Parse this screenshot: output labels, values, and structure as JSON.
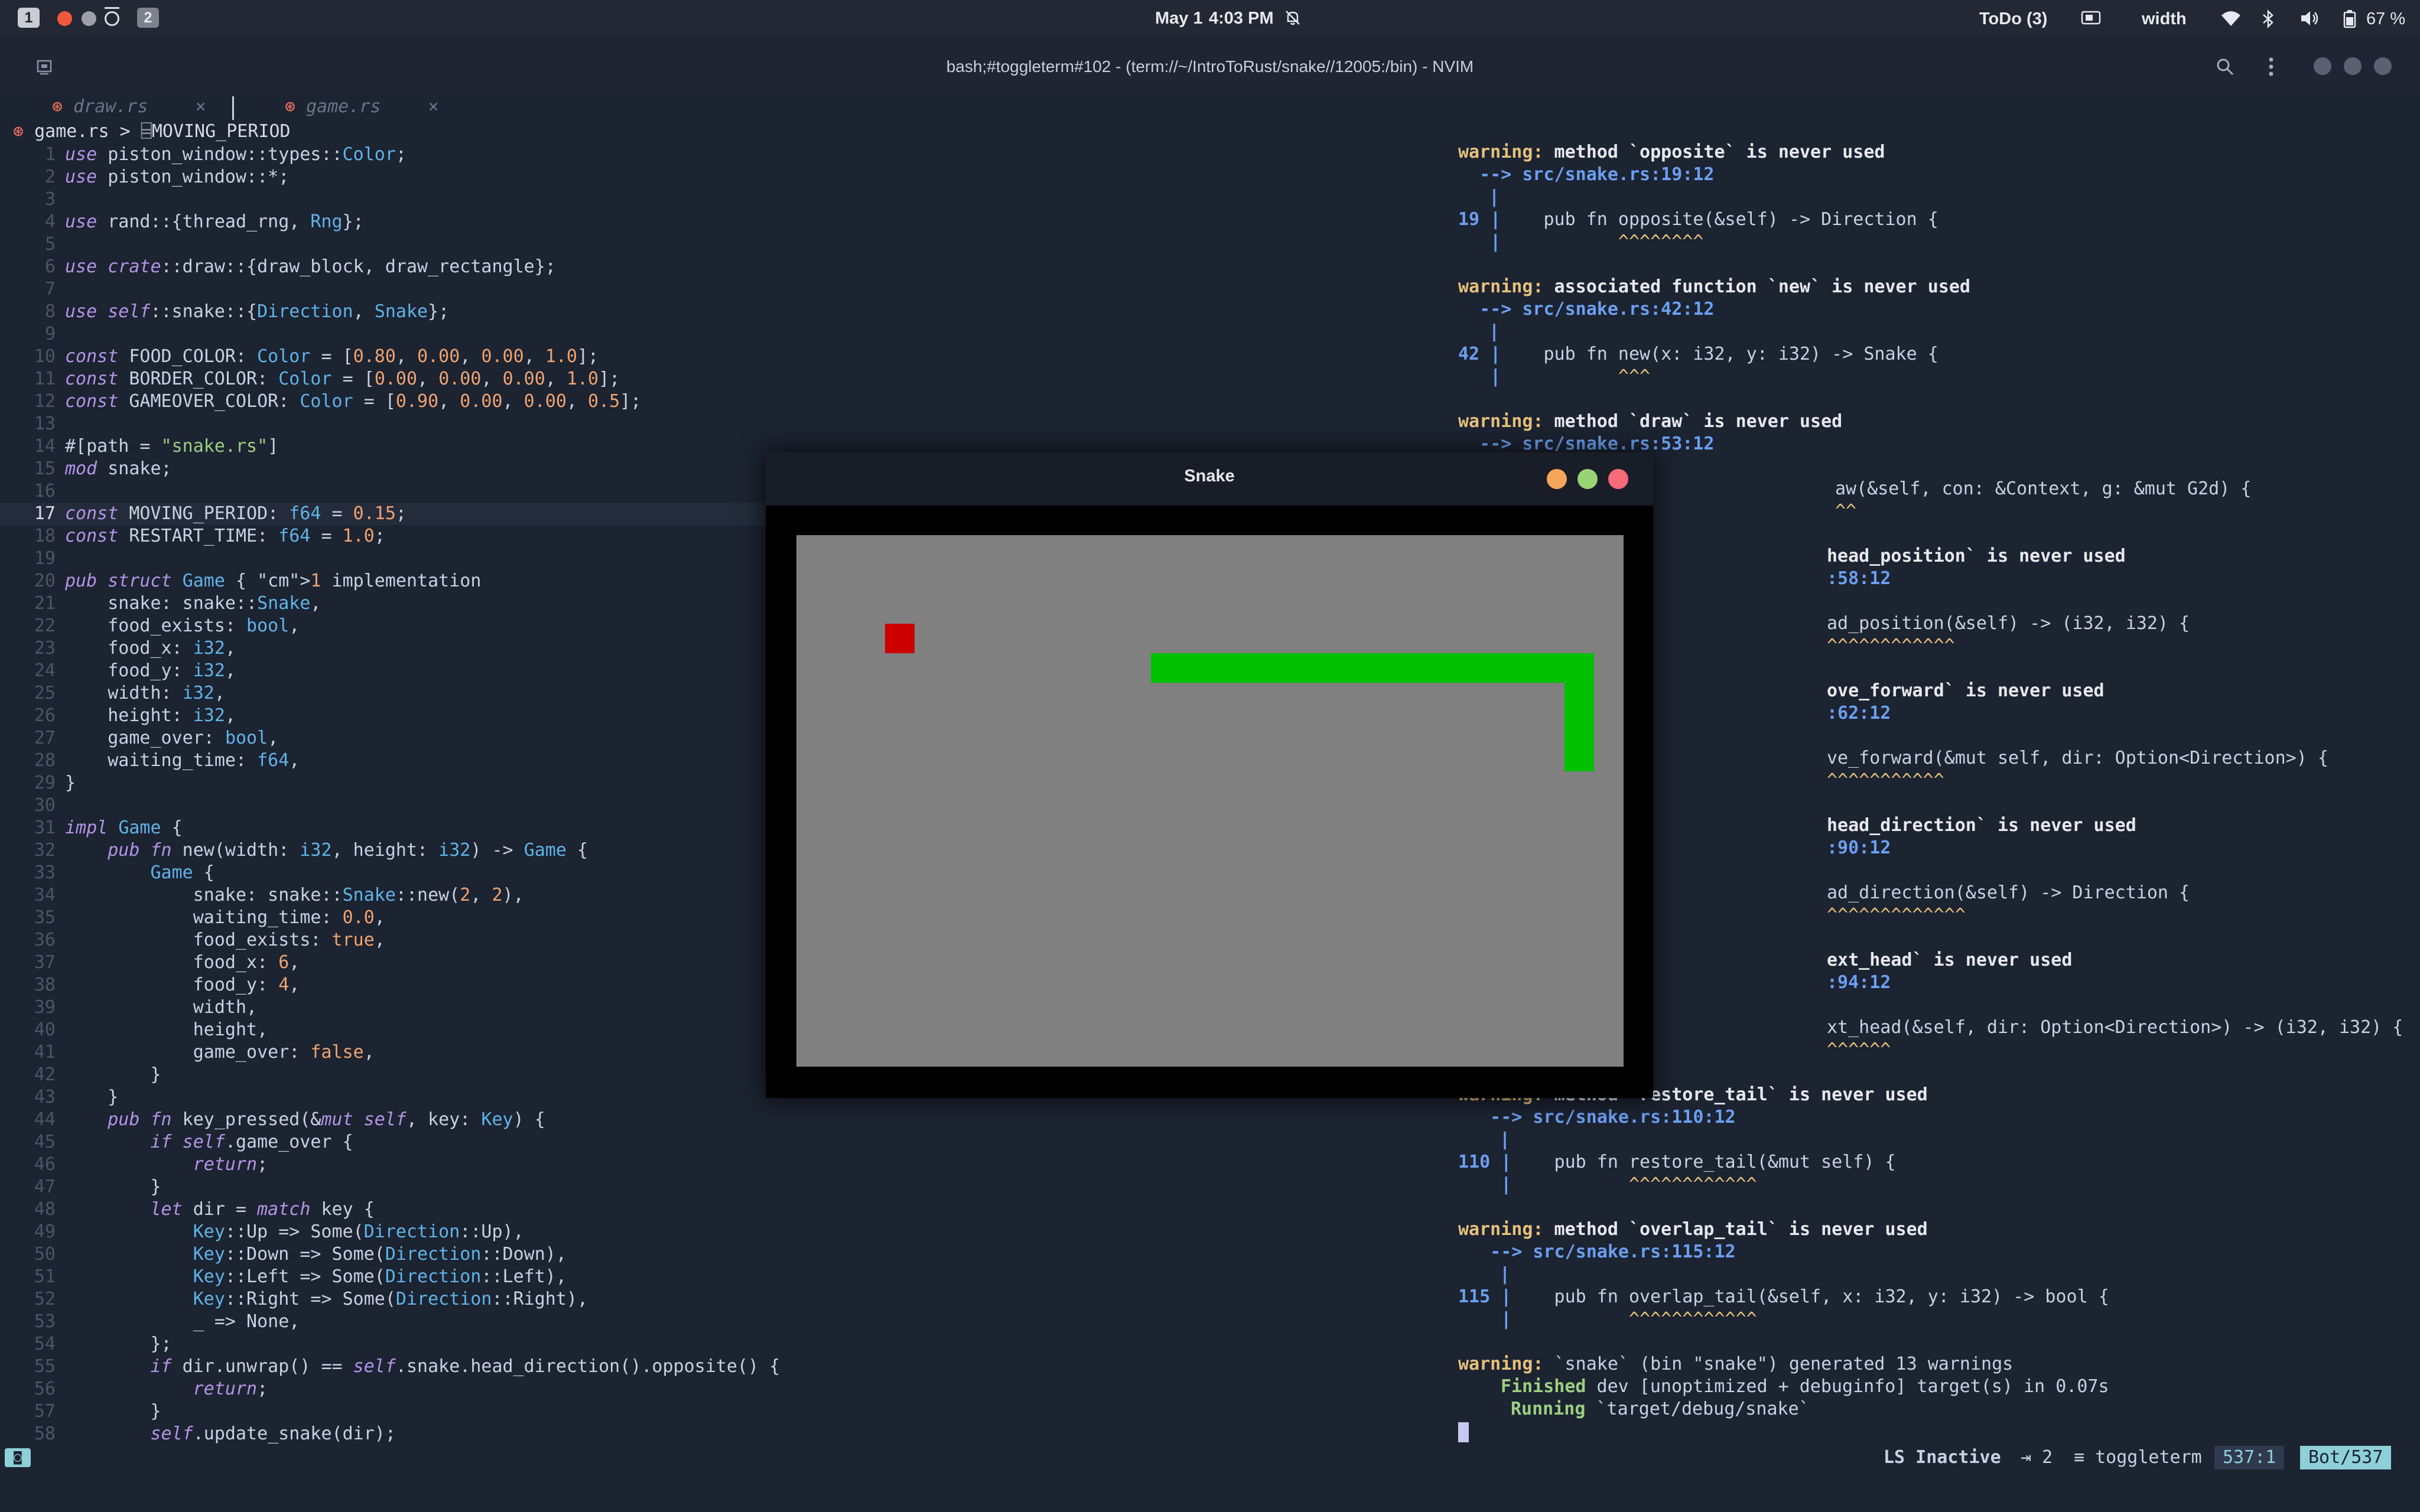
{
  "topbar": {
    "workspace1": "1",
    "workspace2": "2",
    "date": "May 1",
    "time": "4:03 PM",
    "todo": "ToDo (3)",
    "width_label": "width",
    "battery": "67 %"
  },
  "window": {
    "title": "bash;#toggleterm#102 - (term://~/IntroToRust/snake//12005:/bin) - NVIM"
  },
  "editor": {
    "tabs": [
      {
        "label": "draw.rs",
        "close": "×"
      },
      {
        "label": "game.rs",
        "close": "×"
      }
    ],
    "breadcrumb_file": "game.rs",
    "breadcrumb_sep": ">",
    "breadcrumb_symbol": "MOVING_PERIOD"
  },
  "code_lines": [
    "use piston_window::types::Color;",
    "use piston_window::*;",
    "",
    "use rand::{thread_rng, Rng};",
    "",
    "use crate::draw::{draw_block, draw_rectangle};",
    "",
    "use self::snake::{Direction, Snake};",
    "",
    "const FOOD_COLOR: Color = [0.80, 0.00, 0.00, 1.0];",
    "const BORDER_COLOR: Color = [0.00, 0.00, 0.00, 1.0];",
    "const GAMEOVER_COLOR: Color = [0.90, 0.00, 0.00, 0.5];",
    "",
    "#[path = \"snake.rs\"]",
    "mod snake;",
    "",
    "const MOVING_PERIOD: f64 = 0.15;",
    "const RESTART_TIME: f64 = 1.0;",
    "",
    "pub struct Game { 1 implementation",
    "    snake: snake::Snake,",
    "    food_exists: bool,",
    "    food_x: i32,",
    "    food_y: i32,",
    "    width: i32,",
    "    height: i32,",
    "    game_over: bool,",
    "    waiting_time: f64,",
    "}",
    "",
    "impl Game {",
    "    pub fn new(width: i32, height: i32) -> Game {",
    "        Game {",
    "            snake: snake::Snake::new(2, 2),",
    "            waiting_time: 0.0,",
    "            food_exists: true,",
    "            food_x: 6,",
    "            food_y: 4,",
    "            width,",
    "            height,",
    "            game_over: false,",
    "        }",
    "    }",
    "    pub fn key_pressed(&mut self, key: Key) {",
    "        if self.game_over {",
    "            return;",
    "        }",
    "        let dir = match key {",
    "            Key::Up => Some(Direction::Up),",
    "            Key::Down => Some(Direction::Down),",
    "            Key::Left => Some(Direction::Left),",
    "            Key::Right => Some(Direction::Right),",
    "            _ => None,",
    "        };",
    "        if dir.unwrap() == self.snake.head_direction().opposite() {",
    "            return;",
    "        }",
    "        self.update_snake(dir);"
  ],
  "current_line": 17,
  "terminal": {
    "w1": {
      "head": "warning:",
      "msg": " method `opposite` is never used",
      "loc": "  --> src/snake.rs:19:12",
      "num": "19",
      "code": "    pub fn opposite(&self) -> Direction {",
      "carets": "           ^^^^^^^^"
    },
    "w2": {
      "head": "warning:",
      "msg": " associated function `new` is never used",
      "loc": "  --> src/snake.rs:42:12",
      "num": "42",
      "code": "    pub fn new(x: i32, y: i32) -> Snake {",
      "carets": "           ^^^"
    },
    "w3": {
      "head": "warning:",
      "msg": " method `draw` is never used",
      "loc": "  --> src/snake.rs:53:12",
      "code": "aw(&self, con: &Context, g: &mut G2d) {",
      "carets": "^^"
    },
    "w4": {
      "msg": "head_position` is never used",
      "loc": ":58:12",
      "code": "ad_position(&self) -> (i32, i32) {",
      "carets": "^^^^^^^^^^^^"
    },
    "w5": {
      "msg": "ove_forward` is never used",
      "loc": ":62:12",
      "code": "ve_forward(&mut self, dir: Option<Direction>) {",
      "carets": "^^^^^^^^^^^"
    },
    "w6": {
      "msg": "head_direction` is never used",
      "loc": ":90:12",
      "code": "ad_direction(&self) -> Direction {",
      "carets": "^^^^^^^^^^^^^"
    },
    "w7": {
      "msg": "ext_head` is never used",
      "loc": ":94:12",
      "code": "xt_head(&self, dir: Option<Direction>) -> (i32, i32) {",
      "carets": "^^^^^^"
    },
    "w8": {
      "head": "warning:",
      "msg": " method `restore_tail` is never used",
      "loc": "   --> src/snake.rs:110:12",
      "num": "110",
      "code": "    pub fn restore_tail(&mut self) {",
      "carets": "           ^^^^^^^^^^^^"
    },
    "w9": {
      "head": "warning:",
      "msg": " method `overlap_tail` is never used",
      "loc": "   --> src/snake.rs:115:12",
      "num": "115",
      "code": "    pub fn overlap_tail(&self, x: i32, y: i32) -> bool {",
      "carets": "           ^^^^^^^^^^^^"
    },
    "summary_head": "warning:",
    "summary": " `snake` (bin \"snake\") generated 13 warnings",
    "finished_head": "Finished",
    "finished": " dev [unoptimized + debuginfo] target(s) in 0.07s",
    "running_head": "Running",
    "running": " `target/debug/snake`"
  },
  "statusbar": {
    "ls": "LS Inactive",
    "indent": "⇥ 2",
    "filetype": "≡ toggleterm",
    "position": "537:1",
    "scroll": "Bot/537"
  },
  "snake_window": {
    "title": "Snake",
    "colors": {
      "board": "#808080",
      "snake": "#00c000",
      "food": "#cc0000"
    }
  }
}
